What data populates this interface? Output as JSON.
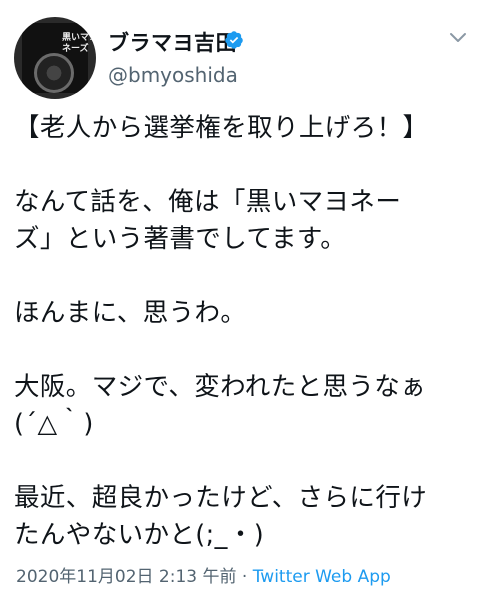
{
  "user": {
    "display_name": "ブラマヨ吉田",
    "handle": "@bmyoshida",
    "verified": true,
    "avatar_text": "黒いマヨネーズ"
  },
  "tweet": {
    "text": "【老人から選挙権を取り上げろ！】\n\nなんて話を、俺は「黒いマヨネー\nズ」という著書でしてます。\n\nほんまに、思うわ。\n\n大阪。マジで、変われたと思うなぁ\n(´△｀)\n\n最近、超良かったけど、さらに行け\nたんやないかと(;_・)",
    "timestamp": "2020年11月02日 2:13 午前",
    "separator": " · ",
    "source": "Twitter Web App"
  },
  "colors": {
    "verified": "#1d9bf0",
    "secondary_text": "#536471",
    "link": "#1d9bf0"
  },
  "icons": {
    "verified": "verified-badge-icon",
    "more": "chevron-down-icon"
  }
}
